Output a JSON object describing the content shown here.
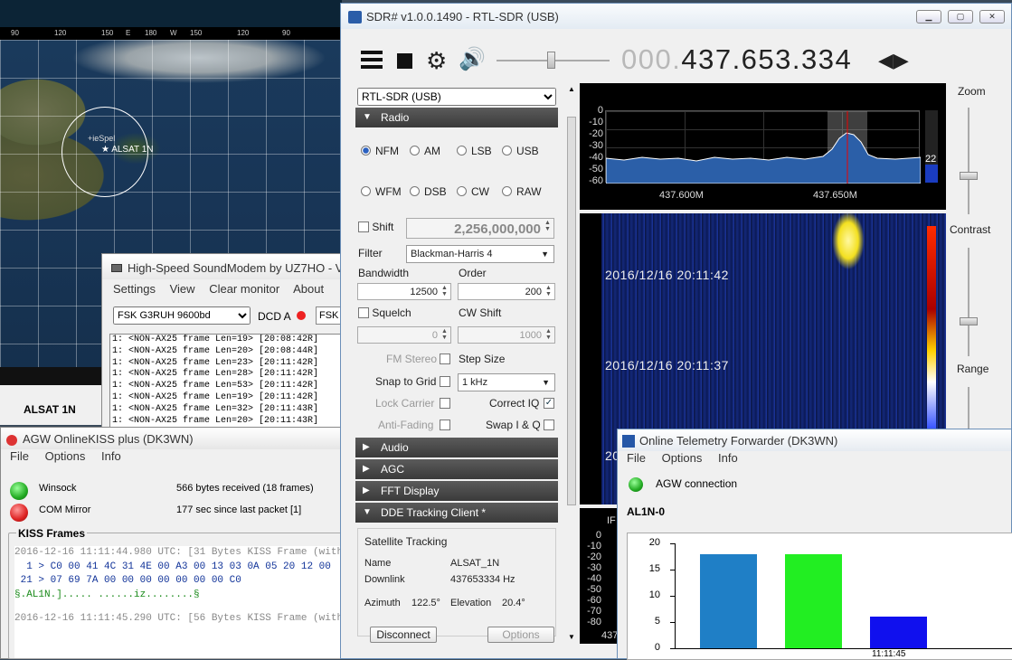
{
  "map": {
    "scale_top": [
      "90",
      "120",
      "150",
      "E",
      "180",
      "W",
      "150",
      "120",
      "90"
    ],
    "footprint_label": "+ieSpel",
    "sat_label": "ALSAT 1N",
    "sat_name": "ALSAT 1N"
  },
  "soundmodem": {
    "title": "High-Speed SoundModem by UZ7HO - V",
    "menu": [
      "Settings",
      "View",
      "Clear monitor",
      "About"
    ],
    "modem": "FSK G3RUH 9600bd",
    "dcd": "DCD A",
    "modem2": "FSK",
    "log": [
      "1: <NON-AX25 frame Len=19> [20:08:42R]",
      "1: <NON-AX25 frame Len=20> [20:08:44R]",
      "1: <NON-AX25 frame Len=23> [20:11:42R]",
      "1: <NON-AX25 frame Len=28> [20:11:42R]",
      "1: <NON-AX25 frame Len=53> [20:11:42R]",
      "1: <NON-AX25 frame Len=19> [20:11:42R]",
      "1: <NON-AX25 frame Len=32> [20:11:43R]",
      "1: <NON-AX25 frame Len=20> [20:11:43R]"
    ]
  },
  "agw": {
    "title": "AGW OnlineKISS plus (DK3WN)",
    "menu": [
      "File",
      "Options",
      "Info"
    ],
    "winsock_label": "Winsock",
    "winsock_status": "566 bytes received (18 frames)",
    "com_label": "COM Mirror",
    "com_status": "177 sec since last packet [1]",
    "kiss_frames_title": "KISS Frames",
    "log_line1": "2016-12-16 11:11:44.980 UTC: [31 Bytes KISS Frame (with",
    "log_line2": "  1 > C0 00 41 4C 31 4E 00 A3 00 13 03 0A 05 20 12 00",
    "log_line3": " 21 > 07 69 7A 00 00 00 00 00 00 00 C0",
    "log_line4": "§.AL1N.]..... ......iz........§",
    "log_line5": "2016-12-16 11:11:45.290 UTC: [56 Bytes KISS Frame (with"
  },
  "sdr": {
    "title": "SDR# v1.0.0.1490 - RTL-SDR (USB)",
    "freq_dim": "000.",
    "freq": "437.653.334",
    "device": "RTL-SDR (USB)",
    "sections": {
      "radio": "Radio",
      "audio": "Audio",
      "agc": "AGC",
      "fft": "FFT Display",
      "dde": "DDE Tracking Client *"
    },
    "modes": [
      "NFM",
      "AM",
      "LSB",
      "USB",
      "WFM",
      "DSB",
      "CW",
      "RAW"
    ],
    "shift_label": "Shift",
    "shift_value": "2,256,000,000",
    "filter_label": "Filter",
    "filter_value": "Blackman-Harris 4",
    "bandwidth_label": "Bandwidth",
    "order_label": "Order",
    "bandwidth_value": "12500",
    "order_value": "200",
    "squelch_label": "Squelch",
    "cwshift_label": "CW Shift",
    "squelch_value": "0",
    "cwshift_value": "1000",
    "fm_stereo": "FM Stereo",
    "step_size": "Step Size",
    "snap_grid": "Snap to Grid",
    "step_value": "1 kHz",
    "lock_carrier": "Lock Carrier",
    "correct_iq": "Correct IQ",
    "anti_fading": "Anti-Fading",
    "swap_iq": "Swap I & Q",
    "dde": {
      "heading": "Satellite Tracking",
      "name_label": "Name",
      "name_value": "ALSAT_1N",
      "downlink_label": "Downlink",
      "downlink_value": "437653334 Hz",
      "azimuth_label": "Azimuth",
      "azimuth_value": "122.5°",
      "elevation_label": "Elevation",
      "elevation_value": "20.4°",
      "disconnect": "Disconnect",
      "options": "Options"
    },
    "spectrum": {
      "y_ticks": [
        "0",
        "-10",
        "-20",
        "-30",
        "-40",
        "-50",
        "-60"
      ],
      "x_ticks": [
        "437.600M",
        "437.650M"
      ],
      "level": "22"
    },
    "waterfall": {
      "ts1": "2016/12/16 20:11:42",
      "ts2": "2016/12/16 20:11:37",
      "ts3": "20"
    },
    "if_panel": {
      "label": "IF",
      "y_ticks": [
        "0",
        "-10",
        "-20",
        "-30",
        "-40",
        "-50",
        "-60",
        "-70",
        "-80"
      ],
      "x_tick": "437"
    },
    "zoom": "Zoom",
    "contrast": "Contrast",
    "range": "Range"
  },
  "otf": {
    "title": "Online Telemetry Forwarder (DK3WN)",
    "menu": [
      "File",
      "Options",
      "Info"
    ],
    "agw_connection": "AGW connection",
    "callsign": "AL1N-0",
    "chart_data": {
      "type": "bar",
      "title": "",
      "xlabel": "",
      "ylabel": "",
      "ylim": [
        0,
        20
      ],
      "y_ticks": [
        "20",
        "15",
        "10",
        "5",
        "0"
      ],
      "categories": [
        "",
        "",
        "11:11:45"
      ],
      "values": [
        18,
        18,
        6
      ],
      "colors": [
        "#1f7fc6",
        "#22ee22",
        "#1010ee"
      ]
    }
  }
}
